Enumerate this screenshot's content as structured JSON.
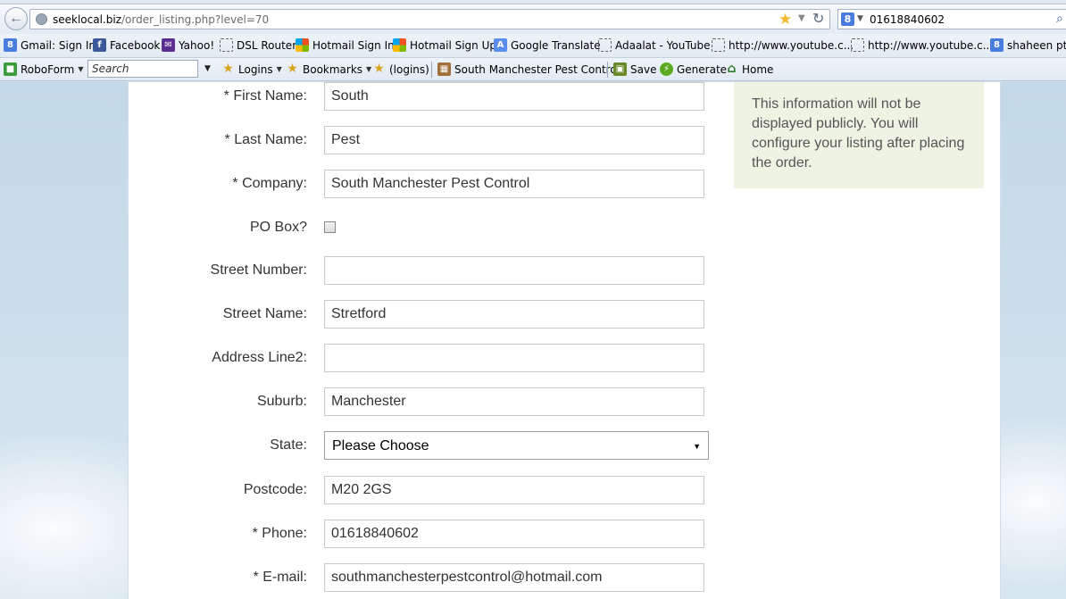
{
  "browser": {
    "url_host": "seeklocal.biz",
    "url_path": "/order_listing.php?level=70",
    "search_query": "01618840602"
  },
  "bookmarks": [
    {
      "label": "Gmail: Sign In",
      "icon": "google-icon"
    },
    {
      "label": "Facebook",
      "icon": "facebook-icon"
    },
    {
      "label": "Yahoo!",
      "icon": "mail-icon"
    },
    {
      "label": "DSL Router",
      "icon": "page-icon"
    },
    {
      "label": "Hotmail Sign In",
      "icon": "windows-icon"
    },
    {
      "label": "Hotmail Sign Up",
      "icon": "windows-icon"
    },
    {
      "label": "Google Translate",
      "icon": "translate-icon"
    },
    {
      "label": "Adaalat - YouTube",
      "icon": "page-icon"
    },
    {
      "label": "http://www.youtube.c...",
      "icon": "page-icon"
    },
    {
      "label": "http://www.youtube.c...",
      "icon": "page-icon"
    },
    {
      "label": "shaheen ptv",
      "icon": "google-icon"
    }
  ],
  "roboform": {
    "label": "RoboForm",
    "search_placeholder": "Search",
    "logins": "Logins",
    "bookmarks": "Bookmarks",
    "logins2": "(logins)",
    "passcard": "South Manchester Pest Control",
    "save": "Save",
    "generate": "Generate",
    "home": "Home"
  },
  "form": {
    "first_name": {
      "label": "* First Name:",
      "value": "South"
    },
    "last_name": {
      "label": "* Last Name:",
      "value": "Pest"
    },
    "company": {
      "label": "* Company:",
      "value": "South Manchester Pest Control"
    },
    "po_box": {
      "label": "PO Box?",
      "checked": false
    },
    "street_number": {
      "label": "Street Number:",
      "value": ""
    },
    "street_name": {
      "label": "Street Name:",
      "value": "Stretford"
    },
    "address_line2": {
      "label": "Address Line2:",
      "value": ""
    },
    "suburb": {
      "label": "Suburb:",
      "value": "Manchester"
    },
    "state": {
      "label": "State:",
      "value": "Please Choose"
    },
    "postcode": {
      "label": "Postcode:",
      "value": "M20 2GS"
    },
    "phone": {
      "label": "* Phone:",
      "value": "01618840602"
    },
    "email": {
      "label": "* E-mail:",
      "value": "southmanchesterpestcontrol@hotmail.com"
    }
  },
  "info_text": "This information will not be displayed publicly. You will configure your listing after placing the order.",
  "colors": {
    "info_bg": "#eef3e4",
    "page_bg": "#cfe0ec"
  }
}
